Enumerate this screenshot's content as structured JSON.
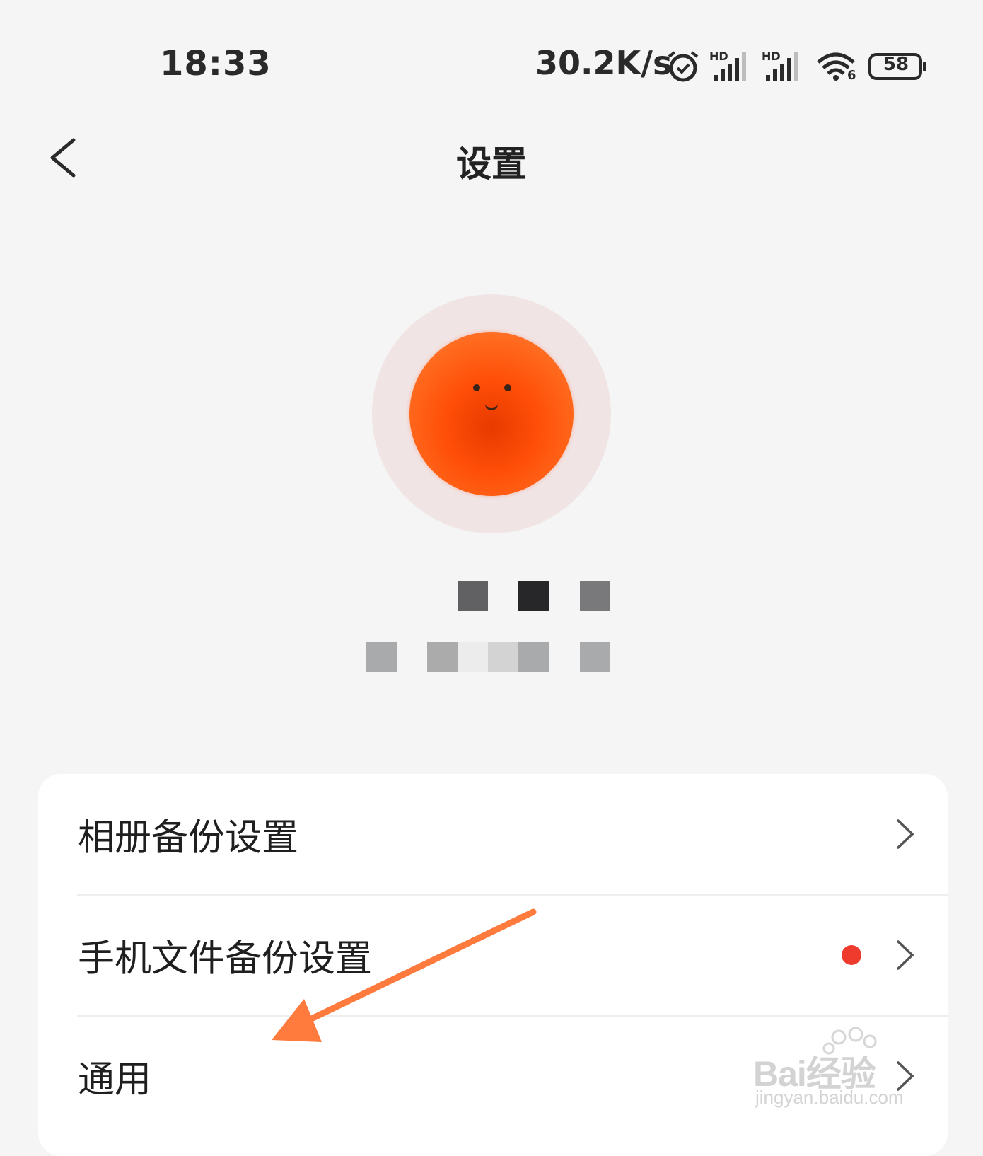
{
  "status_bar": {
    "time": "18:33",
    "net_speed": "30.2K/s",
    "signal_1_label": "HD",
    "signal_2_label": "HD",
    "wifi_label": "6",
    "battery": "58",
    "icons": [
      "alarm-icon",
      "signal-icon",
      "signal-icon",
      "wifi-icon",
      "battery-icon"
    ]
  },
  "header": {
    "title": "设置",
    "back_icon": "chevron-left-icon"
  },
  "profile": {
    "avatar_colors": {
      "halo": "#f1e4e5",
      "ball": "#ff5a14"
    }
  },
  "settings": {
    "items": [
      {
        "label": "相册备份设置",
        "has_dot": false
      },
      {
        "label": "手机文件备份设置",
        "has_dot": true
      },
      {
        "label": "通用",
        "has_dot": false
      }
    ],
    "dot_color": "#ef3b2d"
  },
  "annotation": {
    "arrow_color": "#ff7a3d"
  },
  "watermark": {
    "main": "Bai经验",
    "sub": "jingyan.baidu.com"
  }
}
